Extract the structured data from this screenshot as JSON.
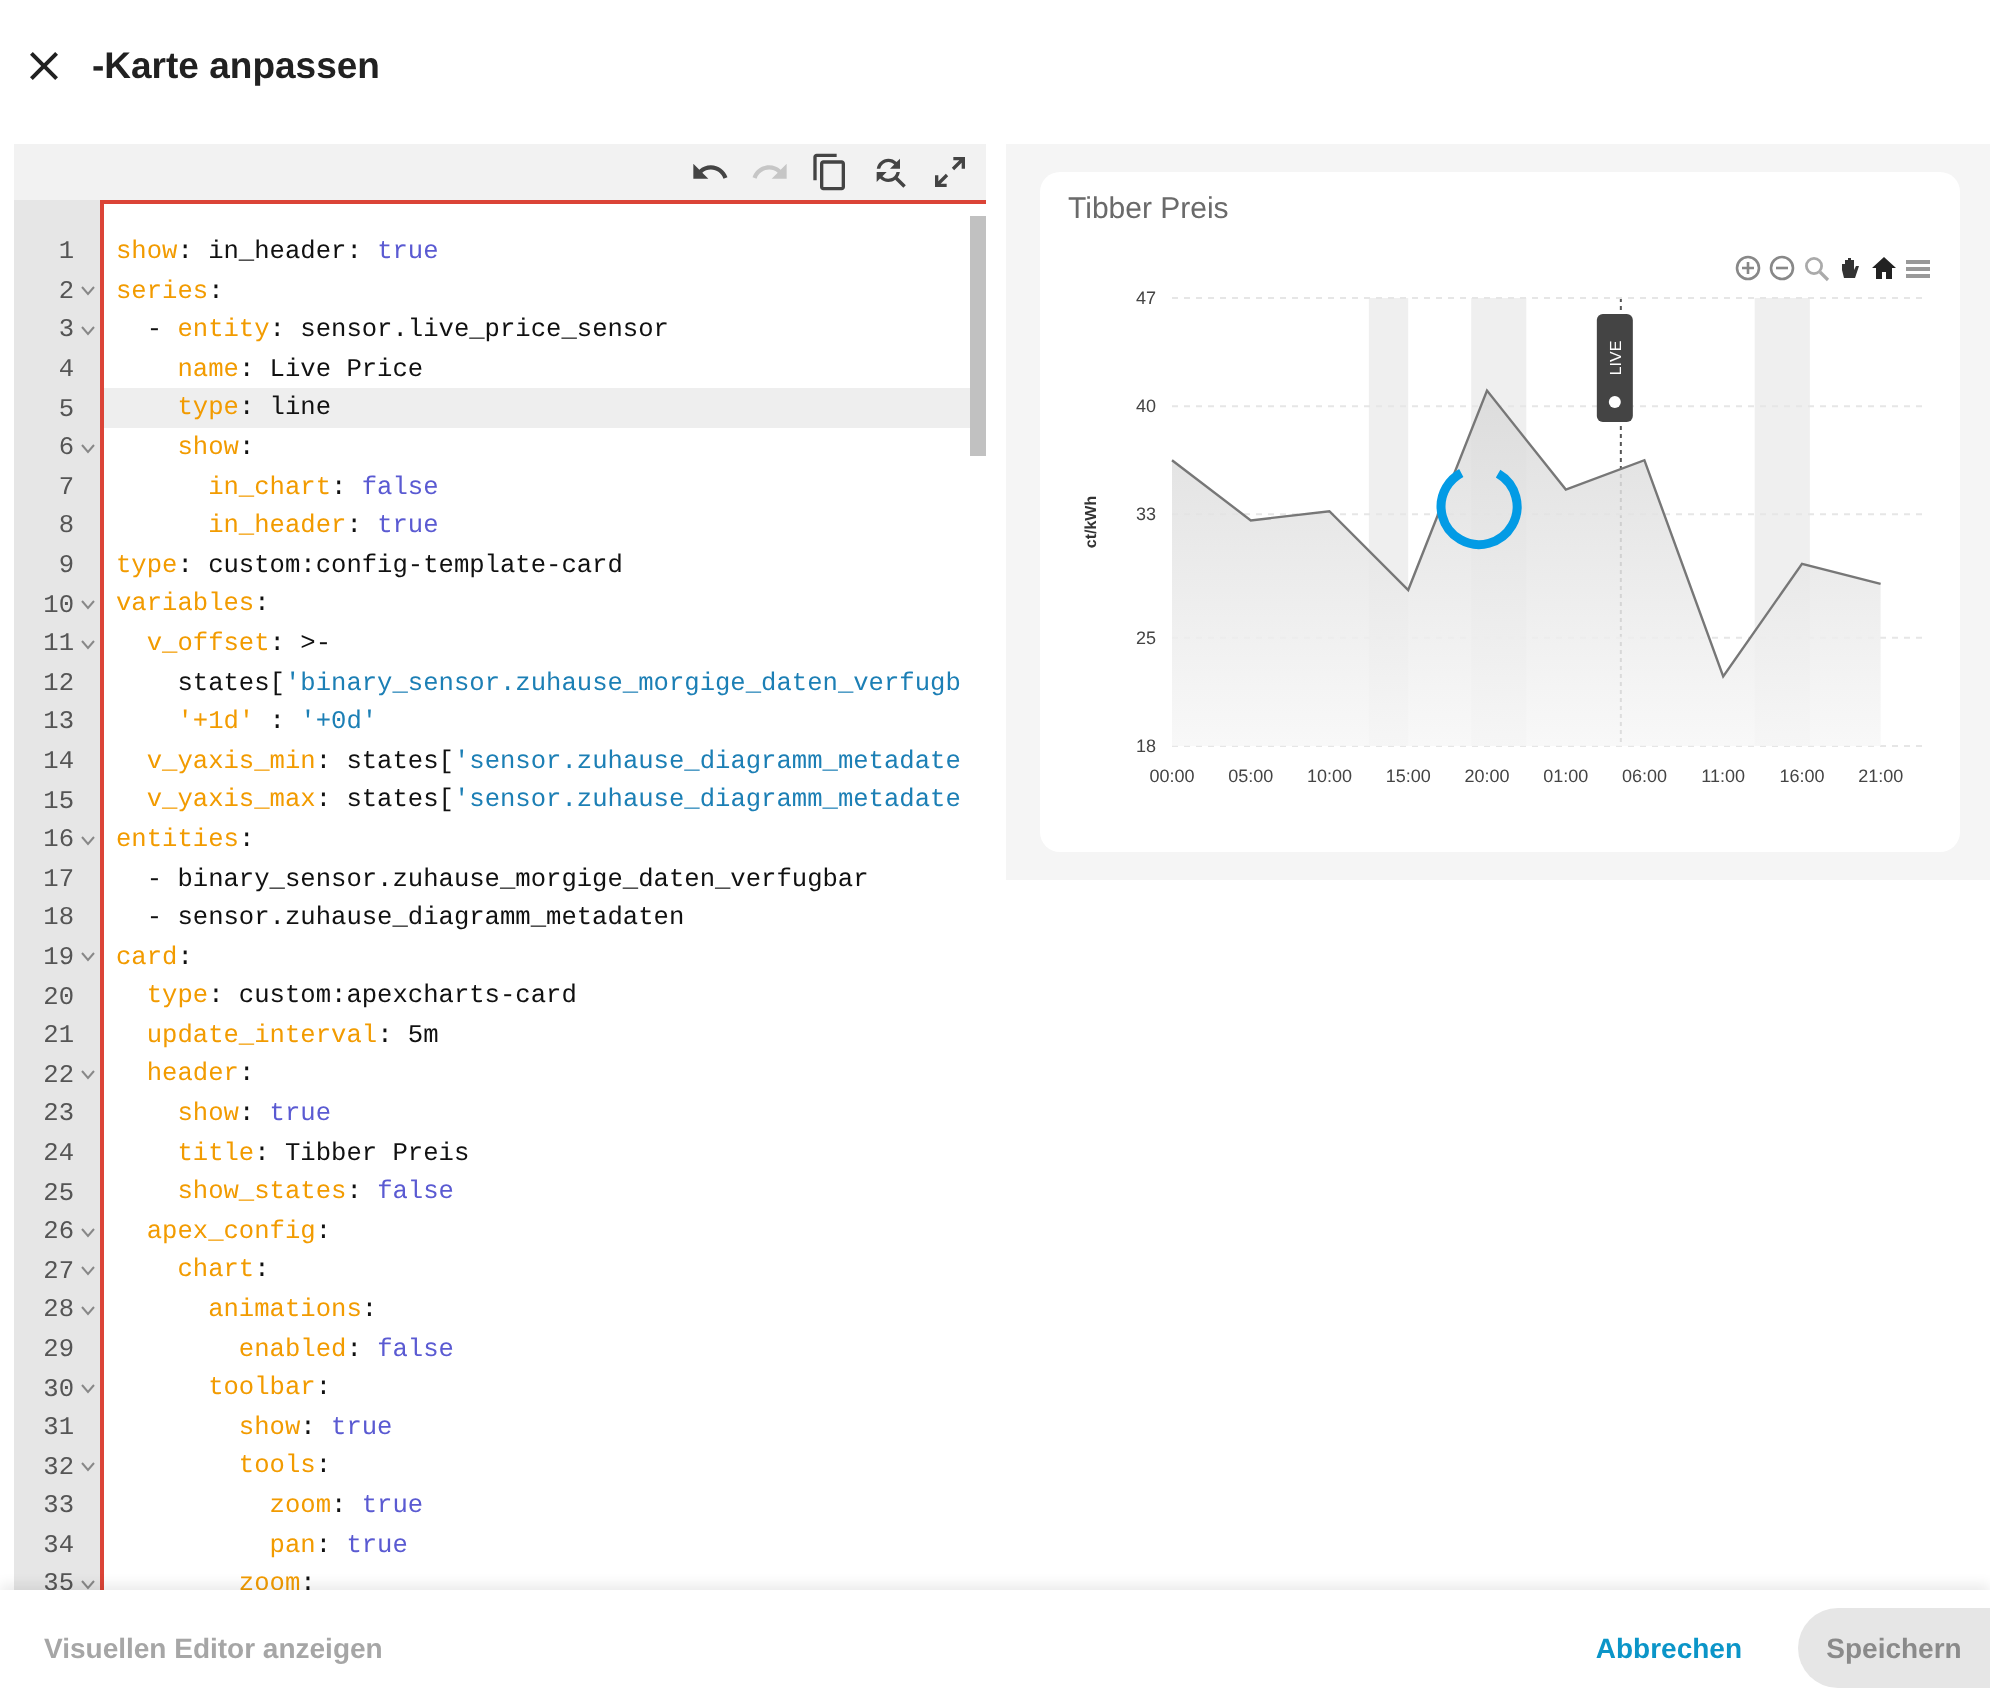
{
  "dialog": {
    "title": "-Karte anpassen"
  },
  "editor_toolbar": [
    {
      "kind": "undo",
      "disabled": false
    },
    {
      "kind": "redo",
      "disabled": true
    },
    {
      "kind": "copy",
      "disabled": false
    },
    {
      "kind": "replace",
      "disabled": false
    },
    {
      "kind": "expand",
      "disabled": false
    }
  ],
  "code_lines": [
    {
      "number": "1",
      "foldable": false,
      "active": false,
      "tokens": [
        {
          "kind": "key",
          "text": "show"
        },
        {
          "kind": "plain",
          "text": ": in_header: "
        },
        {
          "kind": "bool",
          "text": "true"
        }
      ]
    },
    {
      "number": "2",
      "foldable": true,
      "active": false,
      "tokens": [
        {
          "kind": "key",
          "text": "series"
        },
        {
          "kind": "plain",
          "text": ":"
        }
      ]
    },
    {
      "number": "3",
      "foldable": true,
      "active": false,
      "tokens": [
        {
          "kind": "plain",
          "text": "  - "
        },
        {
          "kind": "key",
          "text": "entity"
        },
        {
          "kind": "plain",
          "text": ": sensor.live_price_sensor"
        }
      ]
    },
    {
      "number": "4",
      "foldable": false,
      "active": false,
      "tokens": [
        {
          "kind": "key",
          "text": "    name"
        },
        {
          "kind": "plain",
          "text": ": Live Price"
        }
      ]
    },
    {
      "number": "5",
      "foldable": false,
      "active": true,
      "tokens": [
        {
          "kind": "key",
          "text": "    type"
        },
        {
          "kind": "plain",
          "text": ": line"
        }
      ]
    },
    {
      "number": "6",
      "foldable": true,
      "active": false,
      "tokens": [
        {
          "kind": "key",
          "text": "    show"
        },
        {
          "kind": "plain",
          "text": ":"
        }
      ]
    },
    {
      "number": "7",
      "foldable": false,
      "active": false,
      "tokens": [
        {
          "kind": "key",
          "text": "      in_chart"
        },
        {
          "kind": "plain",
          "text": ": "
        },
        {
          "kind": "bool",
          "text": "false"
        }
      ]
    },
    {
      "number": "8",
      "foldable": false,
      "active": false,
      "tokens": [
        {
          "kind": "key",
          "text": "      in_header"
        },
        {
          "kind": "plain",
          "text": ": "
        },
        {
          "kind": "bool",
          "text": "true"
        }
      ]
    },
    {
      "number": "9",
      "foldable": false,
      "active": false,
      "tokens": [
        {
          "kind": "key",
          "text": "type"
        },
        {
          "kind": "plain",
          "text": ": custom:config-template-card"
        }
      ]
    },
    {
      "number": "10",
      "foldable": true,
      "active": false,
      "tokens": [
        {
          "kind": "key",
          "text": "variables"
        },
        {
          "kind": "plain",
          "text": ":"
        }
      ]
    },
    {
      "number": "11",
      "foldable": true,
      "active": false,
      "tokens": [
        {
          "kind": "key",
          "text": "  v_offset"
        },
        {
          "kind": "plain",
          "text": ": >-"
        }
      ]
    },
    {
      "number": "12",
      "foldable": false,
      "active": false,
      "tokens": [
        {
          "kind": "plain",
          "text": "    states["
        },
        {
          "kind": "string",
          "text": "'binary_sensor.zuhause_morgige_daten_verfugb"
        }
      ]
    },
    {
      "number": "13",
      "foldable": false,
      "active": false,
      "tokens": [
        {
          "kind": "key",
          "text": "    '+1d'"
        },
        {
          "kind": "plain",
          "text": " : "
        },
        {
          "kind": "string",
          "text": "'+0d'"
        }
      ]
    },
    {
      "number": "14",
      "foldable": false,
      "active": false,
      "tokens": [
        {
          "kind": "key",
          "text": "  v_yaxis_min"
        },
        {
          "kind": "plain",
          "text": ": states["
        },
        {
          "kind": "string",
          "text": "'sensor.zuhause_diagramm_metadate"
        }
      ]
    },
    {
      "number": "15",
      "foldable": false,
      "active": false,
      "tokens": [
        {
          "kind": "key",
          "text": "  v_yaxis_max"
        },
        {
          "kind": "plain",
          "text": ": states["
        },
        {
          "kind": "string",
          "text": "'sensor.zuhause_diagramm_metadate"
        }
      ]
    },
    {
      "number": "16",
      "foldable": true,
      "active": false,
      "tokens": [
        {
          "kind": "key",
          "text": "entities"
        },
        {
          "kind": "plain",
          "text": ":"
        }
      ]
    },
    {
      "number": "17",
      "foldable": false,
      "active": false,
      "tokens": [
        {
          "kind": "plain",
          "text": "  - binary_sensor.zuhause_morgige_daten_verfugbar"
        }
      ]
    },
    {
      "number": "18",
      "foldable": false,
      "active": false,
      "tokens": [
        {
          "kind": "plain",
          "text": "  - sensor.zuhause_diagramm_metadaten"
        }
      ]
    },
    {
      "number": "19",
      "foldable": true,
      "active": false,
      "tokens": [
        {
          "kind": "key",
          "text": "card"
        },
        {
          "kind": "plain",
          "text": ":"
        }
      ]
    },
    {
      "number": "20",
      "foldable": false,
      "active": false,
      "tokens": [
        {
          "kind": "key",
          "text": "  type"
        },
        {
          "kind": "plain",
          "text": ": custom:apexcharts-card"
        }
      ]
    },
    {
      "number": "21",
      "foldable": false,
      "active": false,
      "tokens": [
        {
          "kind": "key",
          "text": "  update_interval"
        },
        {
          "kind": "plain",
          "text": ": 5m"
        }
      ]
    },
    {
      "number": "22",
      "foldable": true,
      "active": false,
      "tokens": [
        {
          "kind": "key",
          "text": "  header"
        },
        {
          "kind": "plain",
          "text": ":"
        }
      ]
    },
    {
      "number": "23",
      "foldable": false,
      "active": false,
      "tokens": [
        {
          "kind": "key",
          "text": "    show"
        },
        {
          "kind": "plain",
          "text": ": "
        },
        {
          "kind": "bool",
          "text": "true"
        }
      ]
    },
    {
      "number": "24",
      "foldable": false,
      "active": false,
      "tokens": [
        {
          "kind": "key",
          "text": "    title"
        },
        {
          "kind": "plain",
          "text": ": Tibber Preis"
        }
      ]
    },
    {
      "number": "25",
      "foldable": false,
      "active": false,
      "tokens": [
        {
          "kind": "key",
          "text": "    show_states"
        },
        {
          "kind": "plain",
          "text": ": "
        },
        {
          "kind": "bool",
          "text": "false"
        }
      ]
    },
    {
      "number": "26",
      "foldable": true,
      "active": false,
      "tokens": [
        {
          "kind": "key",
          "text": "  apex_config"
        },
        {
          "kind": "plain",
          "text": ":"
        }
      ]
    },
    {
      "number": "27",
      "foldable": true,
      "active": false,
      "tokens": [
        {
          "kind": "key",
          "text": "    chart"
        },
        {
          "kind": "plain",
          "text": ":"
        }
      ]
    },
    {
      "number": "28",
      "foldable": true,
      "active": false,
      "tokens": [
        {
          "kind": "key",
          "text": "      animations"
        },
        {
          "kind": "plain",
          "text": ":"
        }
      ]
    },
    {
      "number": "29",
      "foldable": false,
      "active": false,
      "tokens": [
        {
          "kind": "key",
          "text": "        enabled"
        },
        {
          "kind": "plain",
          "text": ": "
        },
        {
          "kind": "bool",
          "text": "false"
        }
      ]
    },
    {
      "number": "30",
      "foldable": true,
      "active": false,
      "tokens": [
        {
          "kind": "key",
          "text": "      toolbar"
        },
        {
          "kind": "plain",
          "text": ":"
        }
      ]
    },
    {
      "number": "31",
      "foldable": false,
      "active": false,
      "tokens": [
        {
          "kind": "key",
          "text": "        show"
        },
        {
          "kind": "plain",
          "text": ": "
        },
        {
          "kind": "bool",
          "text": "true"
        }
      ]
    },
    {
      "number": "32",
      "foldable": true,
      "active": false,
      "tokens": [
        {
          "kind": "key",
          "text": "        tools"
        },
        {
          "kind": "plain",
          "text": ":"
        }
      ]
    },
    {
      "number": "33",
      "foldable": false,
      "active": false,
      "tokens": [
        {
          "kind": "key",
          "text": "          zoom"
        },
        {
          "kind": "plain",
          "text": ": "
        },
        {
          "kind": "bool",
          "text": "true"
        }
      ]
    },
    {
      "number": "34",
      "foldable": false,
      "active": false,
      "tokens": [
        {
          "kind": "key",
          "text": "          pan"
        },
        {
          "kind": "plain",
          "text": ": "
        },
        {
          "kind": "bool",
          "text": "true"
        }
      ]
    },
    {
      "number": "35",
      "foldable": true,
      "active": false,
      "tokens": [
        {
          "kind": "key",
          "text": "        zoom"
        },
        {
          "kind": "plain",
          "text": ":"
        }
      ]
    }
  ],
  "preview": {
    "card_title": "Tibber Preis",
    "loading": true,
    "chart_data": {
      "type": "area",
      "ylabel": "ct/kWh",
      "grid": true,
      "categories": [
        "00:00",
        "05:00",
        "10:00",
        "15:00",
        "20:00",
        "01:00",
        "06:00",
        "11:00",
        "16:00",
        "21:00"
      ],
      "series": [
        {
          "color": "#777777",
          "values": [
            36.5,
            32.6,
            33.2,
            28.1,
            41,
            34.6,
            36.5,
            22.5,
            29.8,
            28.5
          ]
        }
      ],
      "ylim": [
        18,
        47
      ],
      "yticks": [
        18,
        25,
        33,
        40,
        47
      ],
      "annotations": [
        "LIVE"
      ]
    }
  },
  "footer": {
    "visual_editor": {
      "label": "Visuellen Editor anzeigen",
      "disabled": true
    },
    "cancel": {
      "label": "Abbrechen"
    },
    "save": {
      "label": "Speichern",
      "disabled": true
    }
  }
}
